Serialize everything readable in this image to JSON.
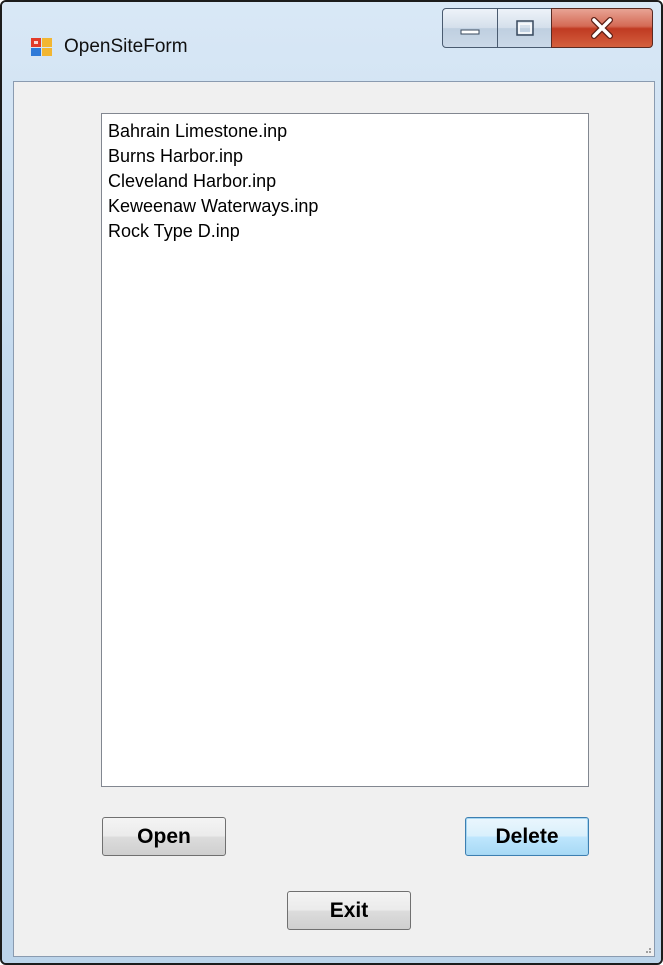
{
  "window": {
    "title": "OpenSiteForm",
    "icon": "winforms-app-icon",
    "caption_buttons": {
      "minimize": "minimize-icon",
      "maximize": "maximize-icon",
      "close": "close-icon"
    }
  },
  "listbox": {
    "items": [
      "Bahrain Limestone.inp",
      "Burns Harbor.inp",
      "Cleveland Harbor.inp",
      "Keweenaw Waterways.inp",
      "Rock Type D.inp"
    ]
  },
  "buttons": {
    "open_label": "Open",
    "delete_label": "Delete",
    "exit_label": "Exit"
  },
  "colors": {
    "client_background": "#f0f0f0",
    "frame": "#c7ddf2",
    "close_button": "#c03a22",
    "default_button_border": "#3c7fb1"
  }
}
